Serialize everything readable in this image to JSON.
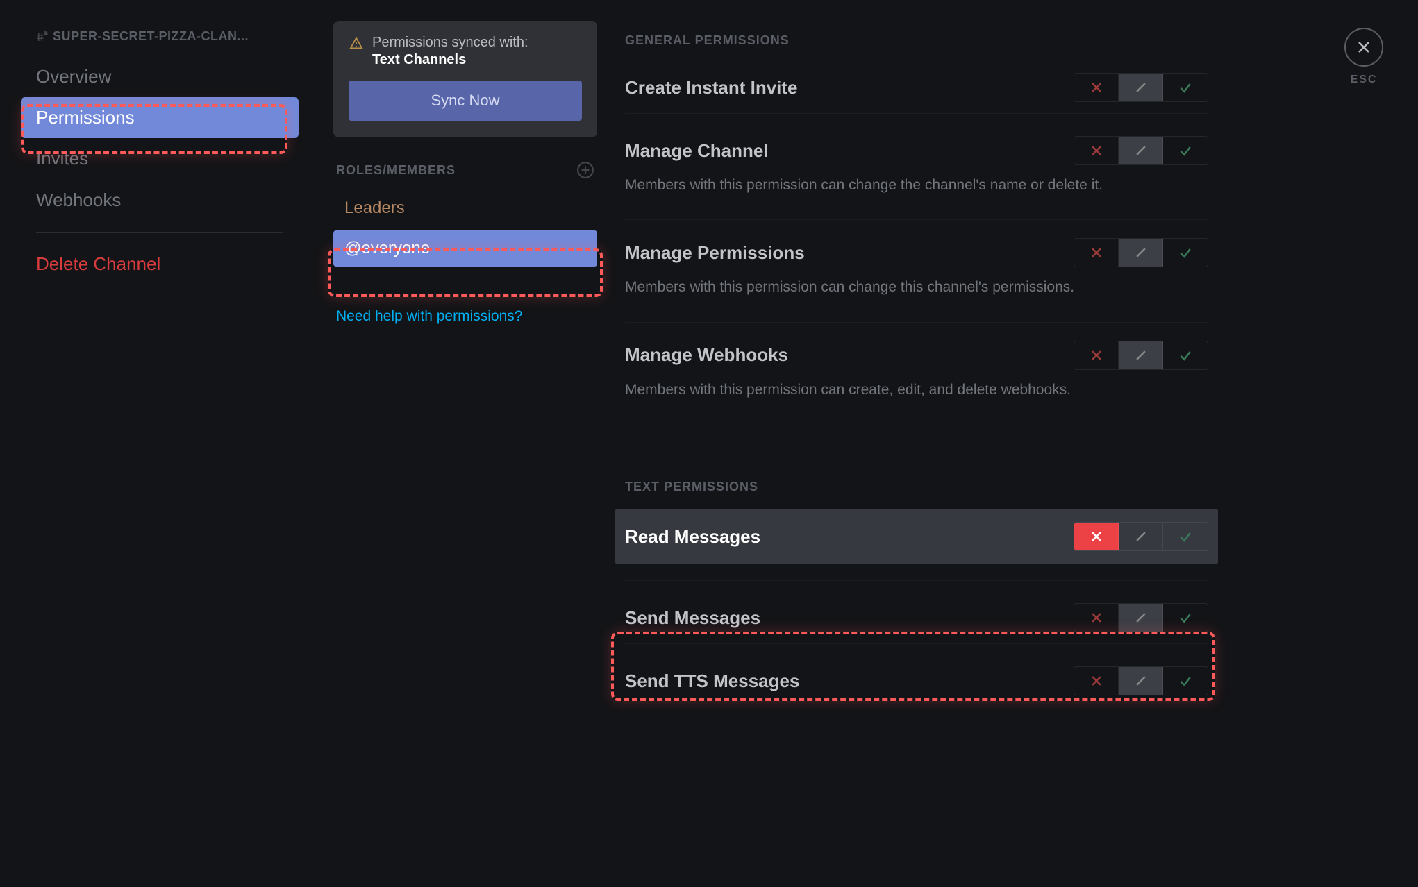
{
  "sidebar": {
    "channel_name": "SUPER-SECRET-PIZZA-CLAN...",
    "items": [
      {
        "label": "Overview",
        "active": false
      },
      {
        "label": "Permissions",
        "active": true
      },
      {
        "label": "Invites",
        "active": false
      },
      {
        "label": "Webhooks",
        "active": false
      }
    ],
    "delete_label": "Delete Channel"
  },
  "sync_card": {
    "line1": "Permissions synced with:",
    "line2": "Text Channels",
    "button": "Sync Now"
  },
  "roles": {
    "header": "ROLES/MEMBERS",
    "items": [
      {
        "name": "Leaders",
        "style": "leaders",
        "selected": false
      },
      {
        "name": "@everyone",
        "style": "everyone",
        "selected": true
      }
    ],
    "help_link": "Need help with permissions?"
  },
  "permissions": {
    "sections": [
      {
        "header": "GENERAL PERMISSIONS",
        "items": [
          {
            "title": "Create Instant Invite",
            "desc": "",
            "state": "neutral",
            "highlight": false
          },
          {
            "title": "Manage Channel",
            "desc": "Members with this permission can change the channel's name or delete it.",
            "state": "neutral",
            "highlight": false
          },
          {
            "title": "Manage Permissions",
            "desc": "Members with this permission can change this channel's permissions.",
            "state": "neutral",
            "highlight": false
          },
          {
            "title": "Manage Webhooks",
            "desc": "Members with this permission can create, edit, and delete webhooks.",
            "state": "neutral",
            "highlight": false
          }
        ]
      },
      {
        "header": "TEXT PERMISSIONS",
        "items": [
          {
            "title": "Read Messages",
            "desc": "",
            "state": "deny",
            "highlight": true
          },
          {
            "title": "Send Messages",
            "desc": "",
            "state": "neutral",
            "highlight": false
          },
          {
            "title": "Send TTS Messages",
            "desc": "",
            "state": "neutral",
            "highlight": false
          }
        ]
      }
    ]
  },
  "close": {
    "esc": "ESC"
  }
}
